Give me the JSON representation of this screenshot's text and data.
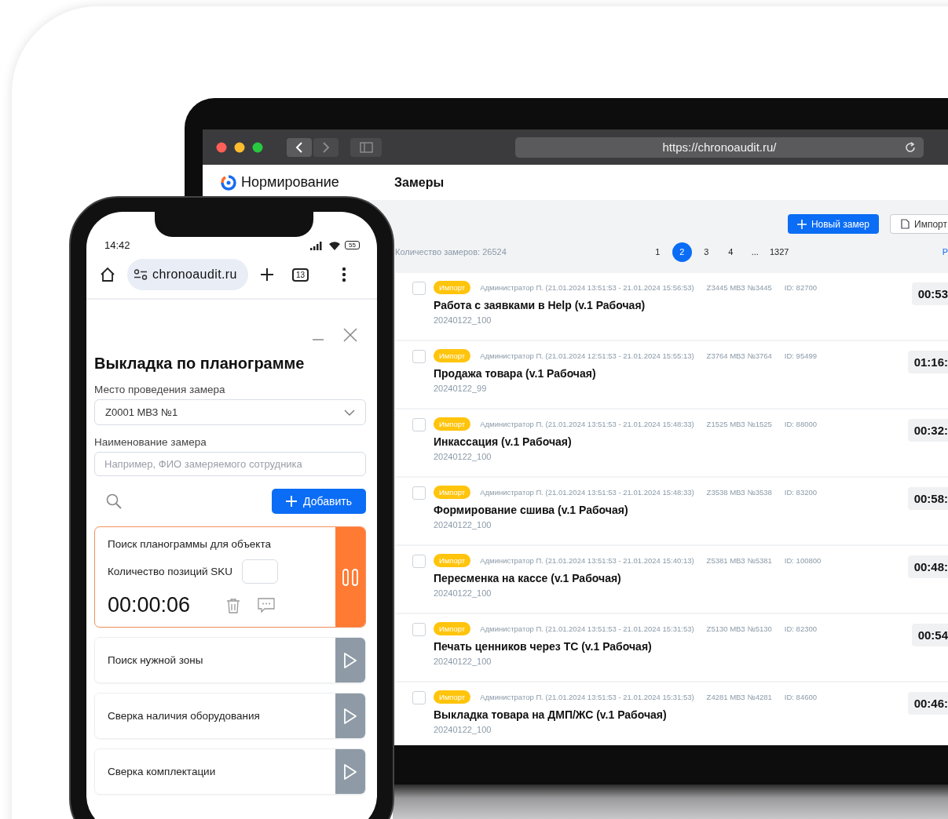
{
  "laptop": {
    "browser": {
      "url": "https://chronoaudit.ru/"
    },
    "app": {
      "logo_text": "Нормирование",
      "section": "Замеры"
    },
    "toolbar": [
      {
        "label": "Новый замер",
        "kind": "primary"
      },
      {
        "label": "Импорт",
        "kind": "secondary"
      }
    ],
    "count": "Количество замеров: 26524",
    "pagination": [
      {
        "label": "1",
        "selected": false
      },
      {
        "label": "2",
        "selected": true
      },
      {
        "label": "3",
        "selected": false
      },
      {
        "label": "4",
        "selected": false
      },
      {
        "label": "...",
        "selected": false
      },
      {
        "label": "1327",
        "selected": false
      }
    ],
    "side_link": "Р",
    "rows": [
      {
        "checked": false,
        "tag": "Импорт",
        "meta": "Администратор П. (21.01.2024 13:51:53 - 21.01.2024 15:56:53)",
        "place": "Z3445 МВЗ №3445",
        "id": "ID: 82700",
        "title": "Работа с заявками в Help (v.1 Рабочая)",
        "code": "20240122_100",
        "time": "00:53"
      },
      {
        "checked": false,
        "tag": "Импорт",
        "meta": "Администратор П. (21.01.2024 12:51:53 - 21.01.2024 15:55:13)",
        "place": "Z3764 МВЗ №3764",
        "id": "ID: 95499",
        "title": "Продажа товара (v.1 Рабочая)",
        "code": "20240122_99",
        "time": "01:16:"
      },
      {
        "checked": false,
        "tag": "Импорт",
        "meta": "Администратор П. (21.01.2024 13:51:53 - 21.01.2024 15:48:33)",
        "place": "Z1525 МВЗ №1525",
        "id": "ID: 88000",
        "title": "Инкассация (v.1 Рабочая)",
        "code": "20240122_100",
        "time": "00:32:"
      },
      {
        "checked": false,
        "tag": "Импорт",
        "meta": "Администратор П. (21.01.2024 13:51:53 - 21.01.2024 15:48:33)",
        "place": "Z3538 МВЗ №3538",
        "id": "ID: 83200",
        "title": "Формирование сшива (v.1 Рабочая)",
        "code": "20240122_100",
        "time": "00:58:"
      },
      {
        "checked": false,
        "tag": "Импорт",
        "meta": "Администратор П. (21.01.2024 13:51:53 - 21.01.2024 15:40:13)",
        "place": "Z5381 МВЗ №5381",
        "id": "ID: 100800",
        "title": "Пересменка на кассе (v.1 Рабочая)",
        "code": "20240122_100",
        "time": "00:48:"
      },
      {
        "checked": false,
        "tag": "Импорт",
        "meta": "Администратор П. (21.01.2024 13:51:53 - 21.01.2024 15:31:53)",
        "place": "Z5130 МВЗ №5130",
        "id": "ID: 82300",
        "title": "Печать ценников через ТС (v.1 Рабочая)",
        "code": "20240122_100",
        "time": "00:54"
      },
      {
        "checked": false,
        "tag": "Импорт",
        "meta": "Администратор П. (21.01.2024 13:51:53 - 21.01.2024 15:31:53)",
        "place": "Z4281 МВЗ №4281",
        "id": "ID: 84600",
        "title": "Выкладка товара на ДМП/ЖС (v.1 Рабочая)",
        "code": "20240122_100",
        "time": "00:46:"
      }
    ]
  },
  "phone": {
    "status": {
      "time": "14:42",
      "battery": "55"
    },
    "browser": {
      "url": "chronoaudit.ru",
      "tabs": "13"
    },
    "dialog": {
      "title": "Выкладка по планограмме",
      "place_label": "Место проведения замера",
      "place_value": "Z0001 МВЗ №1",
      "name_label": "Наименование замера",
      "name_placeholder": "Например, ФИО замеряемого сотрудника",
      "add_button": "Добавить"
    },
    "steps": [
      {
        "title": "Поиск планограммы для объекта",
        "running": true,
        "sku_label": "Количество позиций SKU",
        "elapsed": "00:00:06"
      },
      {
        "title": "Поиск нужной зоны",
        "running": false
      },
      {
        "title": "Сверка наличия оборудования",
        "running": false
      },
      {
        "title": "Сверка комплектации",
        "running": false
      }
    ]
  }
}
